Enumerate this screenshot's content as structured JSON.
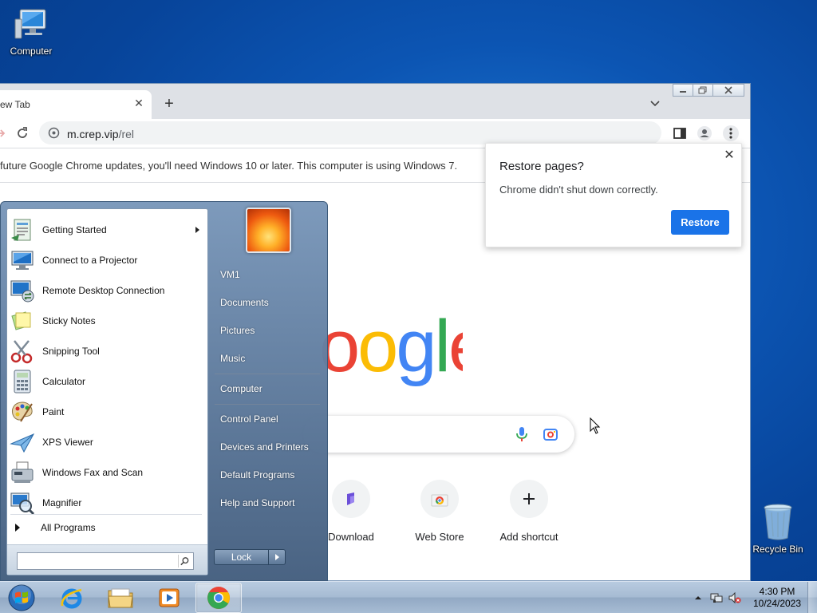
{
  "desktop": {
    "icons": [
      {
        "label": "Computer",
        "icon": "computer-icon"
      },
      {
        "label": "Recycle Bin",
        "icon": "recycle-bin-icon"
      }
    ]
  },
  "chrome": {
    "tab": {
      "title": "ew Tab"
    },
    "omnibox": {
      "url": "m.crep.vip",
      "path": "/rel"
    },
    "infobar": {
      "text": "future Google Chrome updates, you'll need Windows 10 or later. This computer is using Windows 7."
    },
    "shortcuts": [
      {
        "label": "Download"
      },
      {
        "label": "Web Store"
      },
      {
        "label": "Add shortcut"
      }
    ],
    "logo_text": "oogle",
    "logo_colors": {
      "blue": "#4285F4",
      "red": "#EA4335",
      "yellow": "#FBBC05",
      "green": "#34A853"
    },
    "restore_popup": {
      "title": "Restore pages?",
      "message": "Chrome didn't shut down correctly.",
      "button": "Restore"
    }
  },
  "start_menu": {
    "programs": [
      {
        "label": "Getting Started",
        "has_submenu": true
      },
      {
        "label": "Connect to a Projector"
      },
      {
        "label": "Remote Desktop Connection"
      },
      {
        "label": "Sticky Notes"
      },
      {
        "label": "Snipping Tool"
      },
      {
        "label": "Calculator"
      },
      {
        "label": "Paint"
      },
      {
        "label": "XPS Viewer"
      },
      {
        "label": "Windows Fax and Scan"
      },
      {
        "label": "Magnifier"
      }
    ],
    "all_programs": "All Programs",
    "right_items": [
      "VM1",
      "Documents",
      "Pictures",
      "Music",
      "Computer",
      "Control Panel",
      "Devices and Printers",
      "Default Programs",
      "Help and Support"
    ],
    "lock_button": "Lock"
  },
  "taskbar": {
    "time": "4:30 PM",
    "date": "10/24/2023",
    "apps": [
      "internet-explorer",
      "file-explorer",
      "media-player",
      "chrome"
    ]
  },
  "colors": {
    "accent_blue": "#1a73e8"
  }
}
